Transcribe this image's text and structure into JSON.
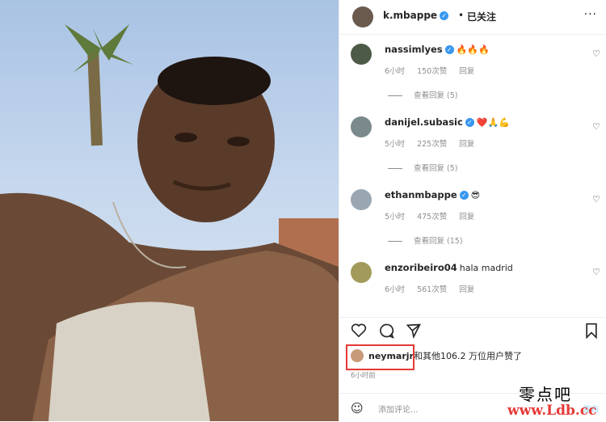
{
  "post": {
    "photo": {
      "description_icon": "user-photo"
    },
    "author": {
      "username": "k.mbappe",
      "follow_state": "已关注",
      "separator": "•",
      "more": "···"
    }
  },
  "comments": [
    {
      "username": "nassimlyes",
      "verified": true,
      "text": "🔥🔥🔥",
      "time": "6小时",
      "likes": "150次赞",
      "reply": "回复",
      "view_replies": "查看回复 (5)"
    },
    {
      "username": "danijel.subasic",
      "verified": true,
      "text": "❤️🙏💪",
      "time": "5小时",
      "likes": "225次赞",
      "reply": "回复",
      "view_replies": "查看回复 (5)"
    },
    {
      "username": "ethanmbappe",
      "verified": true,
      "text": "😎",
      "time": "5小时",
      "likes": "475次赞",
      "reply": "回复",
      "view_replies": "查看回复 (15)"
    },
    {
      "username": "enzoribeiro04",
      "verified": false,
      "text": "hala madrid",
      "time": "6小时",
      "likes": "561次赞",
      "reply": "回复",
      "view_replies": ""
    }
  ],
  "likes": {
    "user": "neymarjr",
    "text": "和其他106.2 万位用户赞了"
  },
  "time_ago": "6小时前",
  "add_comment": {
    "placeholder": "添加评论...",
    "post_label": "发布"
  },
  "watermark": {
    "line1": "零点吧",
    "line2": "www.Ldb.cc"
  },
  "colors": {
    "accent": "#3897f0",
    "highlight": "#e53935"
  }
}
